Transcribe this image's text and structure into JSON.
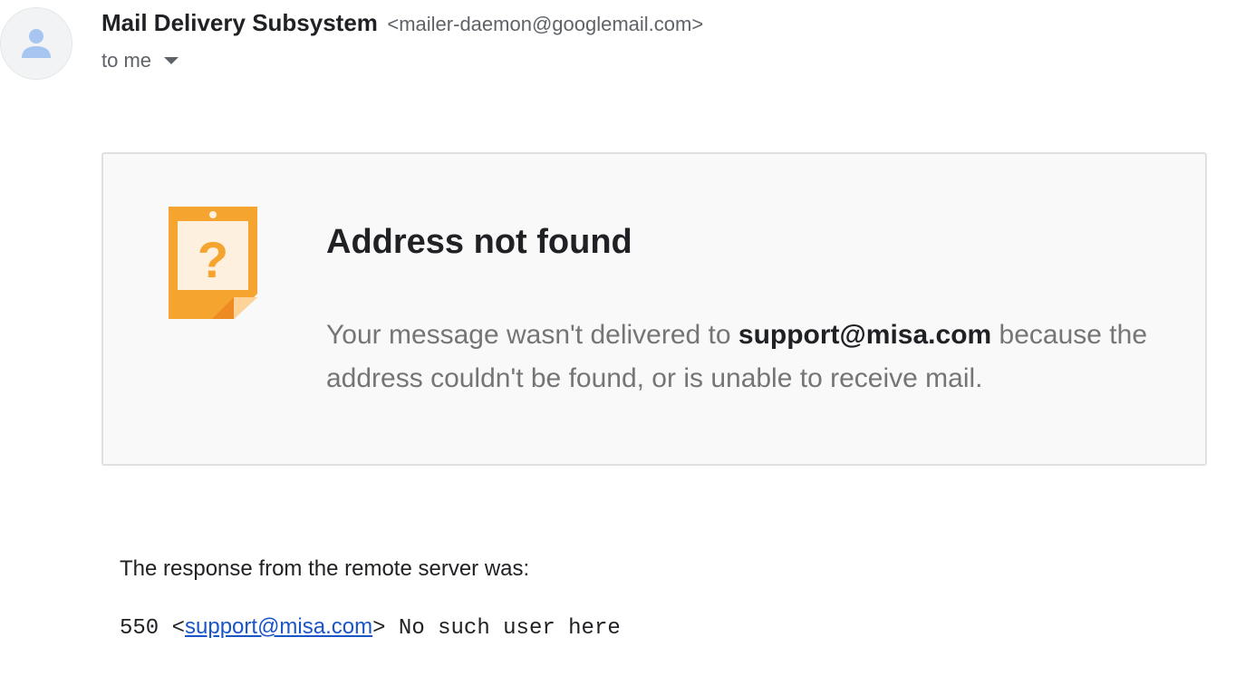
{
  "header": {
    "sender_name": "Mail Delivery Subsystem",
    "sender_email": "<mailer-daemon@googlemail.com>",
    "recipient_label": "to me"
  },
  "bounce_card": {
    "icon": "question-note-icon",
    "title": "Address not found",
    "body_prefix": "Your message wasn't delivered to ",
    "address": "support@misa.com",
    "body_suffix": " because the address couldn't be found, or is unable to receive mail."
  },
  "server_response": {
    "label": "The response from the remote server was:",
    "code": "550 <",
    "address_link": "support@misa.com",
    "message": "> No such user here"
  },
  "colors": {
    "icon_orange": "#f6a430",
    "icon_inner": "#fdf0de",
    "link": "#1a55c8",
    "muted_text": "#757575"
  }
}
